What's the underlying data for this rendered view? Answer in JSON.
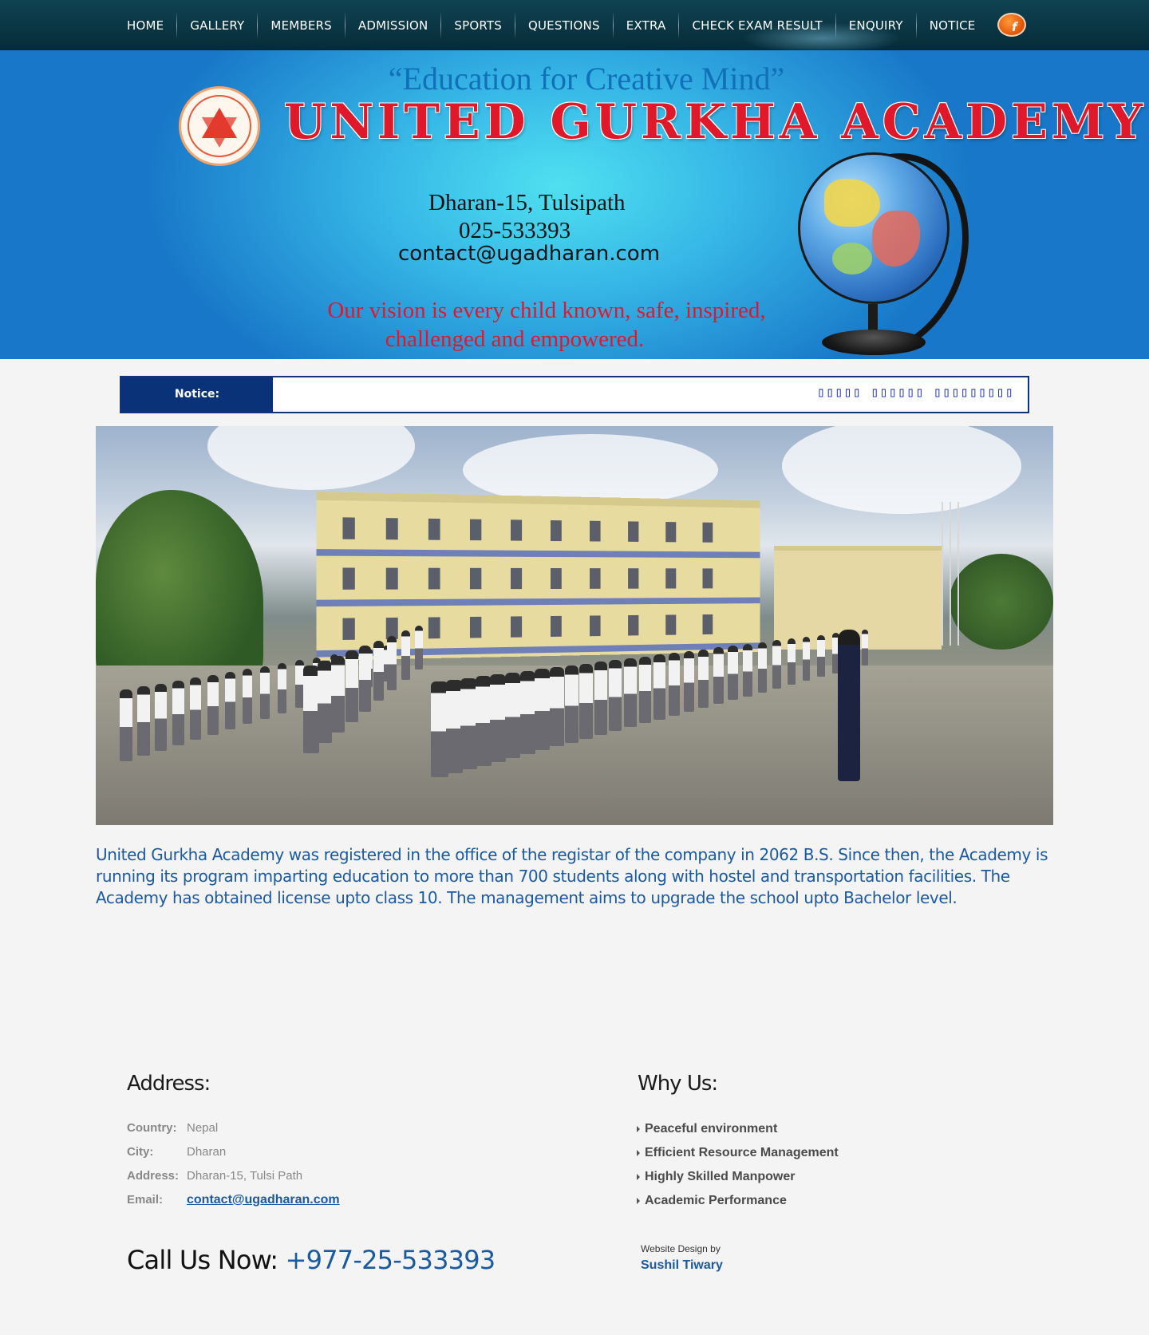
{
  "nav": {
    "items": [
      "HOME",
      "GALLERY",
      "MEMBERS",
      "ADMISSION",
      "SPORTS",
      "QUESTIONS",
      "EXTRA",
      "CHECK EXAM RESULT",
      "ENQUIRY",
      "NOTICE"
    ],
    "facebook_icon": "facebook-icon"
  },
  "banner": {
    "motto": "“Education for Creative Mind”",
    "school_name": "UNITED GURKHA ACADEMY",
    "address": "Dharan-15, Tulsipath",
    "phone": "025-533393",
    "email": "contact@ugadharan.com",
    "vision_line1": "Our vision is every child known, safe, inspired,",
    "vision_line2": "challenged and empowered."
  },
  "notice": {
    "label": "Notice:",
    "scroll_text": "▯▯▯▯▯ ▯▯▯▯▯▯ ▯▯▯▯▯▯▯▯▯"
  },
  "about": "United Gurkha Academy was registered in the office of the registar of the company in 2062 B.S. Since then, the Academy is running its program imparting education to more than 700 students along with hostel and transportation facilities. The Academy has obtained license upto class 10. The management aims to upgrade the school upto Bachelor level.",
  "footer": {
    "address_heading": "Address:",
    "address": {
      "country_label": "Country:",
      "country": "Nepal",
      "city_label": "City:",
      "city": "Dharan",
      "address_label": "Address:",
      "address": "Dharan-15, Tulsi Path",
      "email_label": "Email:",
      "email": "contact@ugadharan.com"
    },
    "why_heading": "Why Us:",
    "why_items": [
      "Peaceful environment",
      "Efficient Resource Management",
      "Highly Skilled Manpower",
      "Academic Performance"
    ],
    "call_label": "Call Us Now:",
    "call_number": "+977-25-533393",
    "credit_label": "Website Design by",
    "credit_name": "Sushil Tiwary"
  },
  "colors": {
    "nav_bg": "#0b3545",
    "accent_blue": "#1a5aa0",
    "brand_red": "#e0192a",
    "notice_blue": "#0a3278"
  }
}
